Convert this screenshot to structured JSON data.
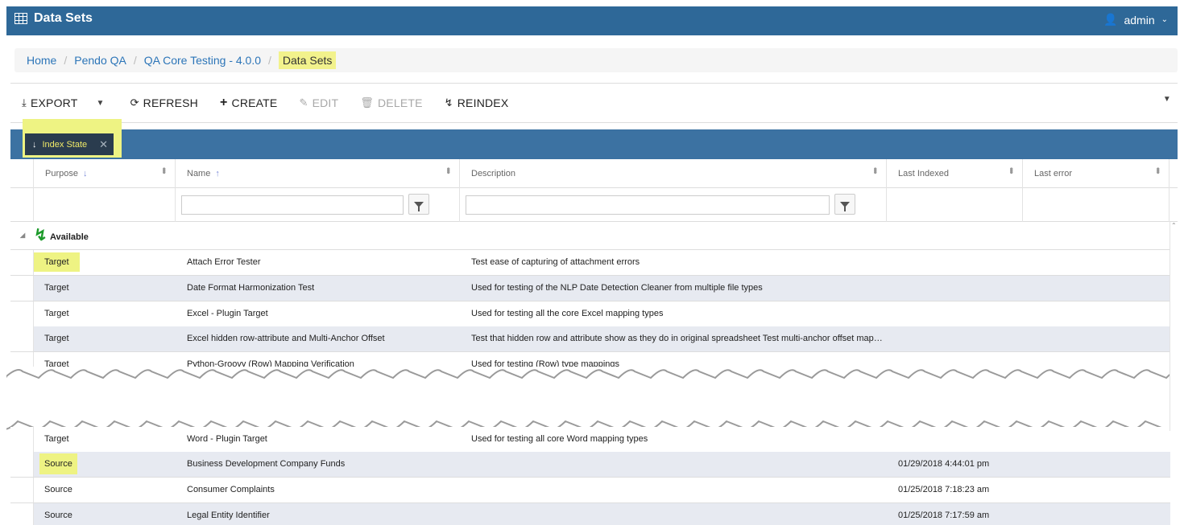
{
  "app": {
    "title": "Data Sets",
    "user": "admin"
  },
  "breadcrumb": [
    "Home",
    "Pendo QA",
    "QA Core Testing - 4.0.0",
    "Data Sets"
  ],
  "toolbar": {
    "export": "EXPORT",
    "refresh": "REFRESH",
    "create": "CREATE",
    "edit": "EDIT",
    "delete": "DELETE",
    "reindex": "REINDEX"
  },
  "grouping": {
    "chip_label": "Index State"
  },
  "columns": {
    "purpose": "Purpose",
    "name": "Name",
    "description": "Description",
    "last_indexed": "Last Indexed",
    "last_error": "Last error"
  },
  "group": {
    "label": "Available"
  },
  "rows": [
    {
      "purpose": "Target",
      "name": "Attach Error Tester",
      "description": "Test ease of capturing of attachment errors",
      "last_indexed": ""
    },
    {
      "purpose": "Target",
      "name": "Date Format Harmonization Test",
      "description": "Used for testing of the NLP Date Detection Cleaner from multiple file types",
      "last_indexed": ""
    },
    {
      "purpose": "Target",
      "name": "Excel - Plugin Target",
      "description": "Used for testing all the core Excel mapping types",
      "last_indexed": ""
    },
    {
      "purpose": "Target",
      "name": "Excel hidden row-attribute and Multi-Anchor Offset",
      "description": "Test that hidden row and attribute show as they do in original spreadsheet Test multi-anchor offset map…",
      "last_indexed": ""
    },
    {
      "purpose": "Target",
      "name": "Python-Groovy (Row) Mapping Verification",
      "description": "Used for testing (Row) type mappings",
      "last_indexed": ""
    },
    {
      "purpose": "Target",
      "name": "Word - Plugin Target",
      "description": "Used for testing all core Word mapping types",
      "last_indexed": ""
    },
    {
      "purpose": "Source",
      "name": "Business Development Company Funds",
      "description": "",
      "last_indexed": "01/29/2018 4:44:01 pm"
    },
    {
      "purpose": "Source",
      "name": "Consumer Complaints",
      "description": "",
      "last_indexed": "01/25/2018 7:18:23 am"
    },
    {
      "purpose": "Source",
      "name": "Legal Entity Identifier",
      "description": "",
      "last_indexed": "01/25/2018 7:17:59 am"
    }
  ]
}
